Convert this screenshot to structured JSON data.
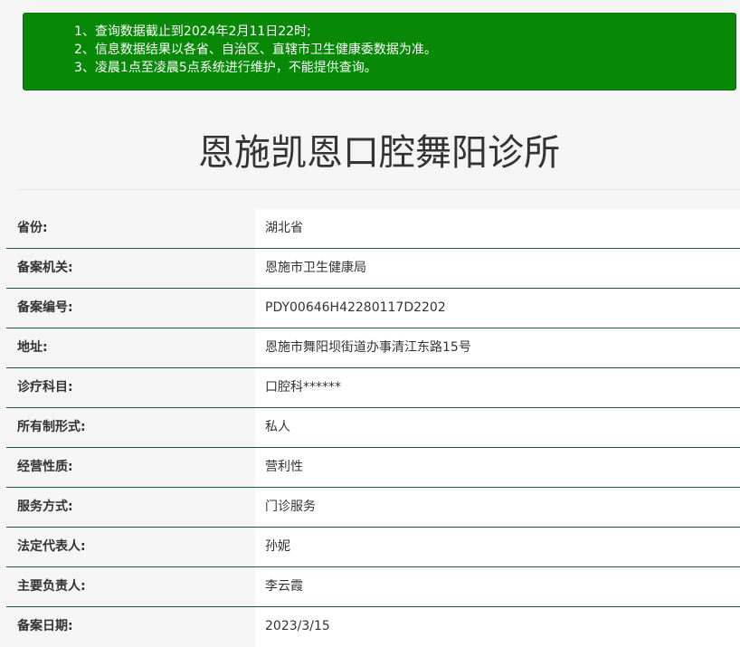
{
  "notice": {
    "lines": [
      "1、查询数据截止到2024年2月11日22时;",
      "2、信息数据结果以各省、自治区、直辖市卫生健康委数据为准。",
      "3、凌晨1点至凌晨5点系统进行维护，不能提供查询。"
    ],
    "background_color": "#078907"
  },
  "page_title": "恩施凯恩口腔舞阳诊所",
  "info": [
    {
      "label": "省份:",
      "value": "湖北省"
    },
    {
      "label": "备案机关:",
      "value": "恩施市卫生健康局"
    },
    {
      "label": "备案编号:",
      "value": "PDY00646H42280117D2202"
    },
    {
      "label": "地址:",
      "value": "恩施市舞阳坝街道办事清江东路15号"
    },
    {
      "label": "诊疗科目:",
      "value": "口腔科******"
    },
    {
      "label": "所有制形式:",
      "value": "私人"
    },
    {
      "label": "经营性质:",
      "value": "营利性"
    },
    {
      "label": "服务方式:",
      "value": "门诊服务"
    },
    {
      "label": "法定代表人:",
      "value": "孙妮"
    },
    {
      "label": "主要负责人:",
      "value": "李云霞"
    },
    {
      "label": "备案日期:",
      "value": "2023/3/15"
    }
  ]
}
